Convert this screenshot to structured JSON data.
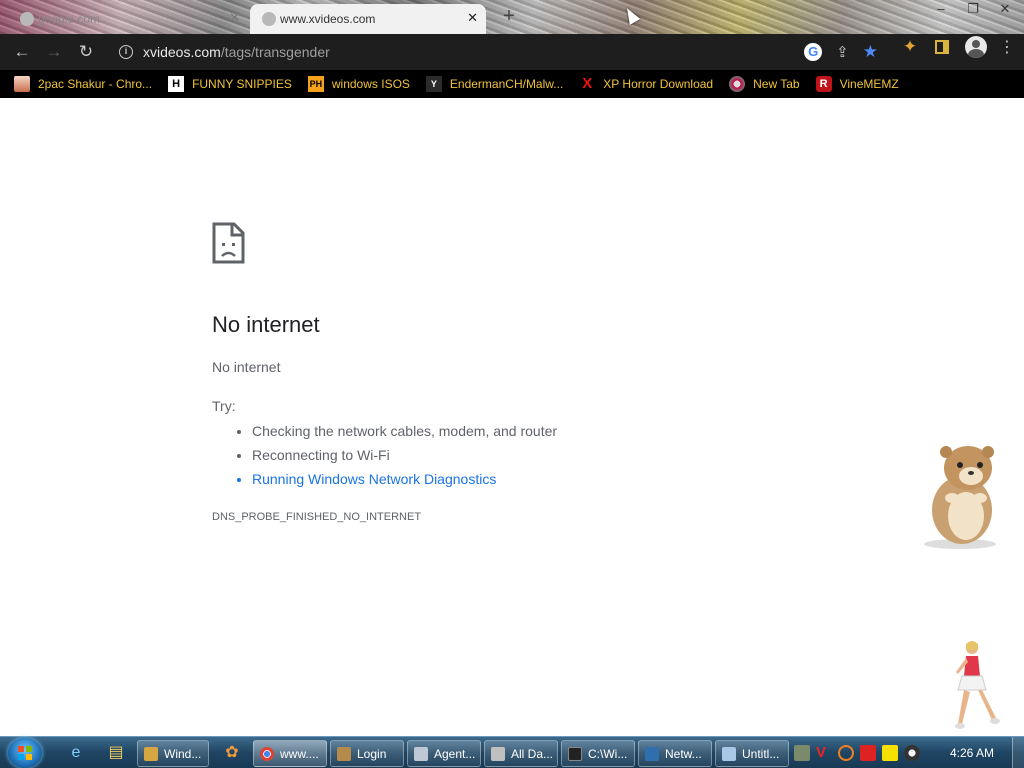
{
  "browser": {
    "tabs": [
      {
        "title": "google.com",
        "active": false
      },
      {
        "title": "www.xvideos.com",
        "active": true
      }
    ],
    "new_tab_symbol": "+",
    "close_symbol": "✕",
    "window_controls": [
      "–",
      "❐",
      "✕"
    ],
    "nav": {
      "back": "←",
      "forward": "→",
      "reload": "↻"
    },
    "omnibox": {
      "domain": "xvideos.com",
      "path": "/tags/transgender"
    },
    "menu_symbol": "⋮"
  },
  "bookmarks": [
    {
      "label": "2pac Shakur - Chro...",
      "icon": "tupac-icon",
      "glyph": ""
    },
    {
      "label": "FUNNY SNIPPIES",
      "icon": "h-icon",
      "glyph": "H"
    },
    {
      "label": "windows ISOS",
      "icon": "ph-icon",
      "glyph": "PH"
    },
    {
      "label": "EndermanCH/Malw...",
      "icon": "yt-icon",
      "glyph": "Y"
    },
    {
      "label": "XP Horror Download",
      "icon": "x-icon",
      "glyph": "X"
    },
    {
      "label": "New Tab",
      "icon": "newtab-icon",
      "glyph": ""
    },
    {
      "label": "VineMEMZ",
      "icon": "r-icon",
      "glyph": "R"
    }
  ],
  "error_page": {
    "title": "No internet",
    "subtitle": "No internet",
    "try_label": "Try:",
    "suggestions": [
      "Checking the network cables, modem, and router",
      "Reconnecting to Wi-Fi",
      "Running Windows Network Diagnostics"
    ],
    "error_code": "DNS_PROBE_FINISHED_NO_INTERNET"
  },
  "taskbar": {
    "buttons": [
      {
        "label": "Wind...",
        "color": "#d6a640"
      },
      {
        "label": "www....",
        "color": "#4caf50"
      },
      {
        "label": "Login",
        "color": "#b58a4a"
      },
      {
        "label": "Agent...",
        "color": "#bfc9d6"
      },
      {
        "label": "All Da...",
        "color": "#c0c0c0"
      },
      {
        "label": "C:\\Wi...",
        "color": "#222222"
      },
      {
        "label": "Netw...",
        "color": "#2f6fb0"
      },
      {
        "label": "Untitl...",
        "color": "#a9c8e8"
      }
    ],
    "clock": "4:26 AM"
  }
}
